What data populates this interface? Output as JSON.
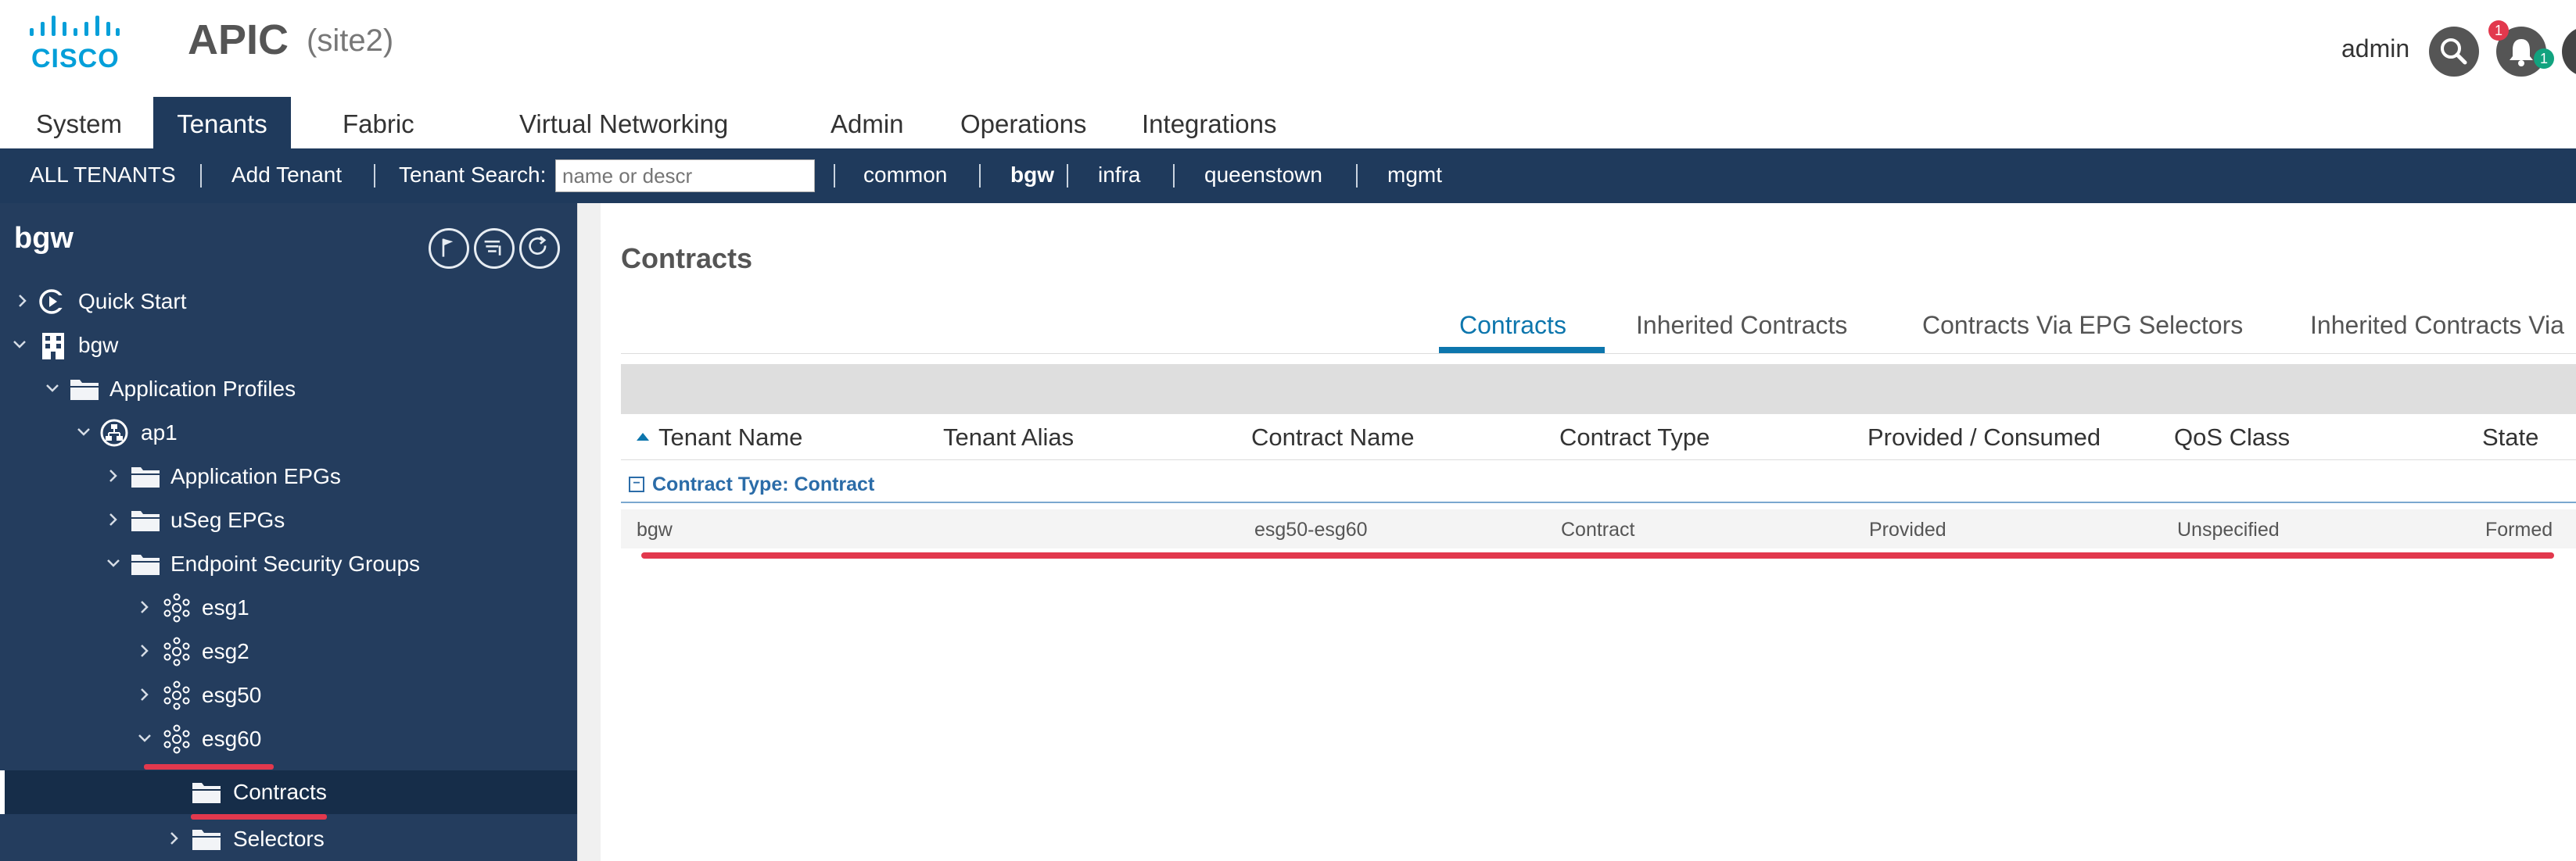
{
  "header": {
    "logo_text": "CISCO",
    "app_title": "APIC",
    "site": "(site2)",
    "user": "admin",
    "notification_badge": "1",
    "alert_badge": "1"
  },
  "main_nav": {
    "tabs": [
      {
        "label": "System"
      },
      {
        "label": "Tenants"
      },
      {
        "label": "Fabric"
      },
      {
        "label": "Virtual Networking"
      },
      {
        "label": "Admin"
      },
      {
        "label": "Operations"
      },
      {
        "label": "Integrations"
      }
    ],
    "active": "Tenants"
  },
  "sub_nav": {
    "all_tenants": "ALL TENANTS",
    "add_tenant": "Add Tenant",
    "tenant_search_label": "Tenant Search:",
    "tenant_search_placeholder": "name or descr",
    "tenants": [
      "common",
      "bgw",
      "infra",
      "queenstown",
      "mgmt"
    ],
    "selected_tenant": "bgw"
  },
  "left_pane": {
    "title": "bgw",
    "tree": [
      {
        "label": "Quick Start",
        "icon": "quick-start-icon",
        "expanded": false
      },
      {
        "label": "bgw",
        "icon": "tenant-building-icon",
        "expanded": true
      },
      {
        "label": "Application Profiles",
        "icon": "folder-icon",
        "expanded": true
      },
      {
        "label": "ap1",
        "icon": "app-profile-icon",
        "expanded": true
      },
      {
        "label": "Application EPGs",
        "icon": "folder-icon",
        "expanded": false
      },
      {
        "label": "uSeg EPGs",
        "icon": "folder-icon",
        "expanded": false
      },
      {
        "label": "Endpoint Security Groups",
        "icon": "folder-icon",
        "expanded": true
      },
      {
        "label": "esg1",
        "icon": "esg-icon",
        "expanded": false
      },
      {
        "label": "esg2",
        "icon": "esg-icon",
        "expanded": false
      },
      {
        "label": "esg50",
        "icon": "esg-icon",
        "expanded": false
      },
      {
        "label": "esg60",
        "icon": "esg-icon",
        "expanded": true
      },
      {
        "label": "Contracts",
        "icon": "folder-icon",
        "selected": true
      },
      {
        "label": "Selectors",
        "icon": "folder-icon",
        "expanded": false
      }
    ]
  },
  "content": {
    "title": "Contracts",
    "tabs": [
      {
        "label": "Contracts"
      },
      {
        "label": "Inherited Contracts"
      },
      {
        "label": "Contracts Via EPG Selectors"
      },
      {
        "label": "Inherited Contracts Via"
      }
    ],
    "active_tab": "Contracts",
    "columns": [
      "Tenant Name",
      "Tenant Alias",
      "Contract Name",
      "Contract Type",
      "Provided / Consumed",
      "QoS Class",
      "State"
    ],
    "group_label": "Contract Type: Contract",
    "rows": [
      [
        "bgw",
        "",
        "esg50-esg60",
        "Contract",
        "Provided",
        "Unspecified",
        "Formed"
      ]
    ]
  },
  "colors": {
    "nav_dark": "#1f3a5c",
    "tree_bg": "#243d5e",
    "accent_blue": "#0d76ad",
    "annotation_red": "#e2384d"
  }
}
